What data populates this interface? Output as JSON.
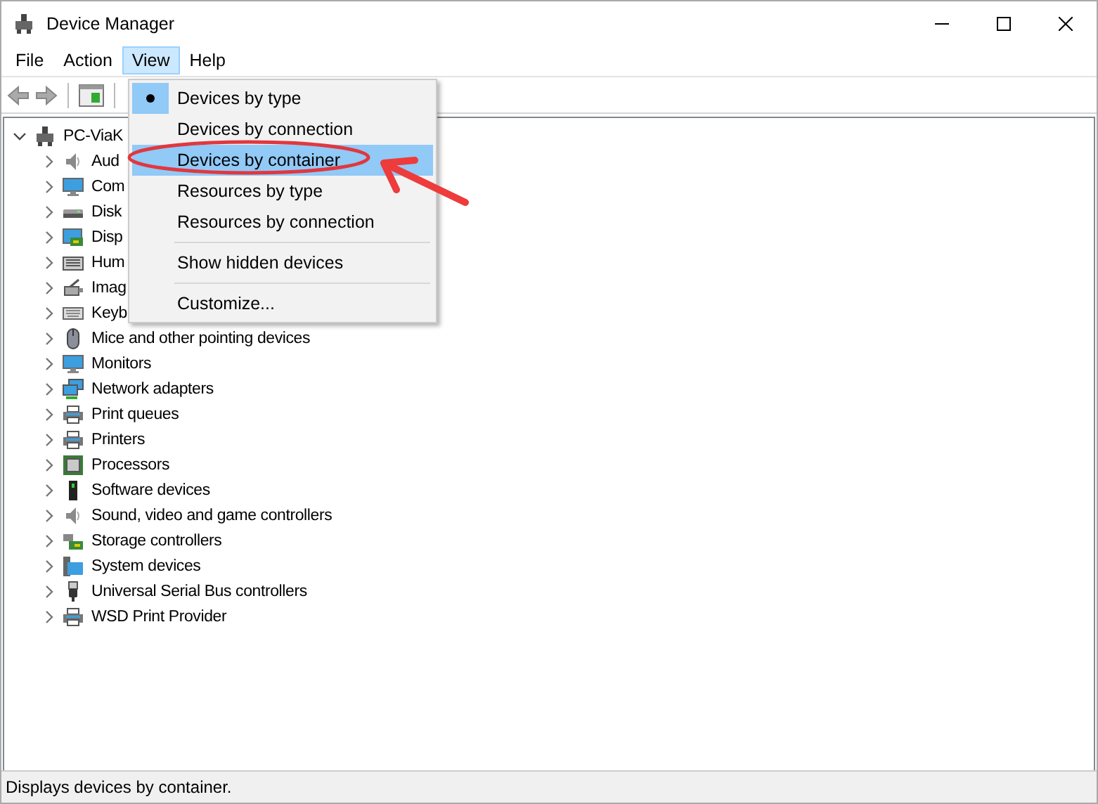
{
  "window": {
    "title": "Device Manager"
  },
  "menubar": [
    {
      "label": "File",
      "selected": false
    },
    {
      "label": "Action",
      "selected": false
    },
    {
      "label": "View",
      "selected": true
    },
    {
      "label": "Help",
      "selected": false
    }
  ],
  "tree": {
    "label": "PC-ViaK",
    "expanded": true,
    "children": [
      {
        "label": "Aud",
        "expanded": false
      },
      {
        "label": "Com",
        "expanded": false
      },
      {
        "label": "Disk",
        "expanded": false
      },
      {
        "label": "Disp",
        "expanded": false
      },
      {
        "label": "Hum",
        "expanded": false
      },
      {
        "label": "Imag",
        "expanded": false
      },
      {
        "label": "Keyb",
        "expanded": false
      },
      {
        "label": "Mice and other pointing devices",
        "expanded": false
      },
      {
        "label": "Monitors",
        "expanded": false
      },
      {
        "label": "Network adapters",
        "expanded": false
      },
      {
        "label": "Print queues",
        "expanded": false
      },
      {
        "label": "Printers",
        "expanded": false
      },
      {
        "label": "Processors",
        "expanded": false
      },
      {
        "label": "Software devices",
        "expanded": false
      },
      {
        "label": "Sound, video and game controllers",
        "expanded": false
      },
      {
        "label": "Storage controllers",
        "expanded": false
      },
      {
        "label": "System devices",
        "expanded": false
      },
      {
        "label": "Universal Serial Bus controllers",
        "expanded": false
      },
      {
        "label": "WSD Print Provider",
        "expanded": false
      }
    ]
  },
  "view_menu": {
    "items": [
      {
        "kind": "item",
        "label": "Devices by type",
        "checked": true,
        "selected": false
      },
      {
        "kind": "item",
        "label": "Devices by connection",
        "checked": false,
        "selected": false
      },
      {
        "kind": "item",
        "label": "Devices by container",
        "checked": false,
        "selected": true
      },
      {
        "kind": "item",
        "label": "Resources by type",
        "checked": false,
        "selected": false
      },
      {
        "kind": "item",
        "label": "Resources by connection",
        "checked": false,
        "selected": false
      },
      {
        "kind": "separator"
      },
      {
        "kind": "item",
        "label": "Show hidden devices",
        "checked": false,
        "selected": false
      },
      {
        "kind": "separator"
      },
      {
        "kind": "item",
        "label": "Customize...",
        "checked": false,
        "selected": false
      }
    ]
  },
  "status_bar": {
    "text": "Displays devices by container."
  }
}
